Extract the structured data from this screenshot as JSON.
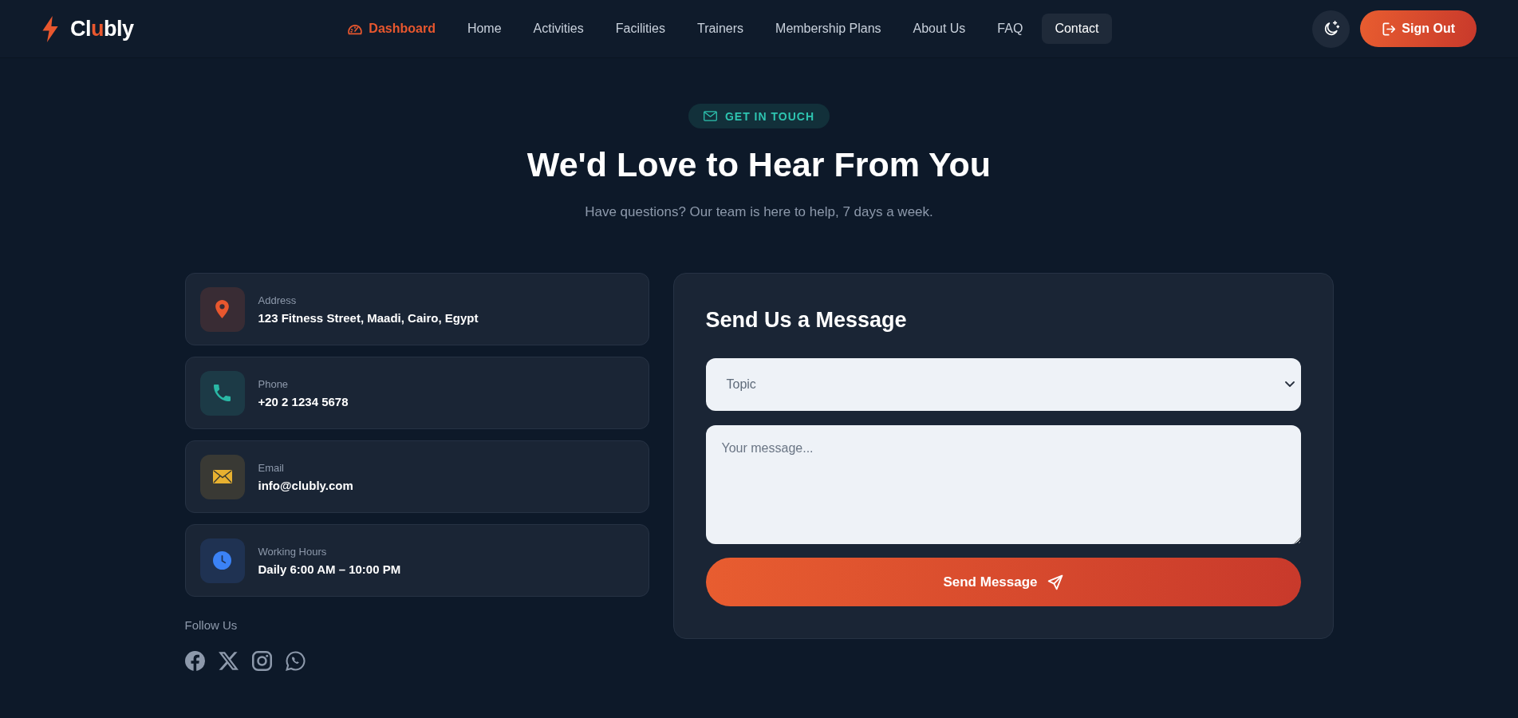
{
  "header": {
    "logo": {
      "segments": [
        {
          "text": "Cl",
          "accent": false
        },
        {
          "text": "u",
          "accent": true
        },
        {
          "text": "bly",
          "accent": false
        }
      ]
    },
    "nav": [
      {
        "label": "Dashboard",
        "kind": "dashboard",
        "selected": false
      },
      {
        "label": "Home",
        "kind": "link",
        "selected": false
      },
      {
        "label": "Activities",
        "kind": "link",
        "selected": false
      },
      {
        "label": "Facilities",
        "kind": "link",
        "selected": false
      },
      {
        "label": "Trainers",
        "kind": "link",
        "selected": false
      },
      {
        "label": "Membership Plans",
        "kind": "link",
        "selected": false
      },
      {
        "label": "About Us",
        "kind": "link",
        "selected": false
      },
      {
        "label": "FAQ",
        "kind": "link",
        "selected": false
      },
      {
        "label": "Contact",
        "kind": "link",
        "selected": true
      }
    ],
    "sign_out": {
      "label": "Sign Out"
    }
  },
  "hero": {
    "badge": "GET IN TOUCH",
    "title": "We'd Love to Hear From You",
    "subtitle": "Have questions? Our team is here to help, 7 days a week."
  },
  "contact_items": [
    {
      "kind": "location",
      "label": "Address",
      "value": "123 Fitness Street, Maadi, Cairo, Egypt",
      "color": "#e8572e"
    },
    {
      "kind": "phone",
      "label": "Phone",
      "value": "+20 2 1234 5678",
      "color": "#2ab8a5"
    },
    {
      "kind": "email",
      "label": "Email",
      "value": "info@clubly.com",
      "color": "#e8b130"
    },
    {
      "kind": "hours",
      "label": "Working Hours",
      "value": "Daily 6:00 AM – 10:00 PM",
      "color": "#3b82f6"
    }
  ],
  "follow_us": {
    "label": "Follow Us"
  },
  "form": {
    "title": "Send Us a Message",
    "topic": {
      "placeholder": "Topic"
    },
    "message": {
      "placeholder": "Your message..."
    },
    "submit": {
      "label": "Send Message"
    }
  }
}
